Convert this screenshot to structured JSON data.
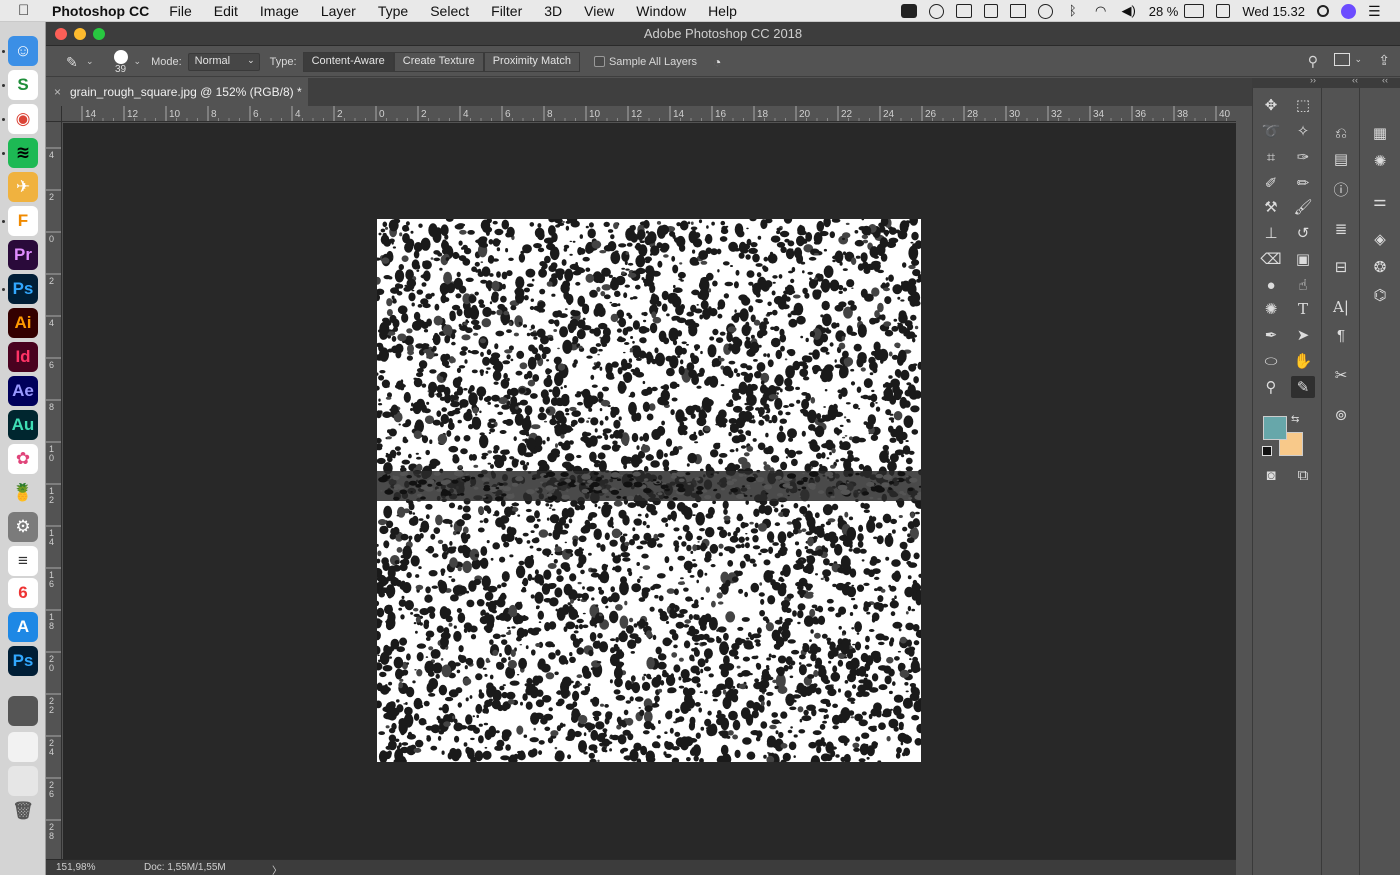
{
  "menubar": {
    "app_name": "Photoshop CC",
    "menus": [
      "File",
      "Edit",
      "Image",
      "Layer",
      "Type",
      "Select",
      "Filter",
      "3D",
      "View",
      "Window",
      "Help"
    ],
    "battery": "28 %",
    "clock": "Wed 15.32"
  },
  "window": {
    "title": "Adobe Photoshop CC 2018"
  },
  "options_bar": {
    "brush_size": "39",
    "mode_label": "Mode:",
    "mode_value": "Normal",
    "type_label": "Type:",
    "type_options": [
      "Content-Aware",
      "Create Texture",
      "Proximity Match"
    ],
    "sample_all_layers": "Sample All Layers"
  },
  "document": {
    "tab_title": "grain_rough_square.jpg @ 152% (RGB/8) *"
  },
  "ruler": {
    "top_ticks": [
      "14",
      "12",
      "10",
      "8",
      "6",
      "4",
      "2",
      "0",
      "2",
      "4",
      "6",
      "8",
      "10",
      "12",
      "14",
      "16",
      "18",
      "20",
      "22",
      "24",
      "26",
      "28",
      "30",
      "32",
      "34",
      "36",
      "38",
      "40"
    ],
    "left_ticks": [
      "4",
      "2",
      "0",
      "2",
      "4",
      "6",
      "8",
      "10",
      "12",
      "14",
      "16",
      "18",
      "20",
      "22",
      "24",
      "26",
      "28",
      "3"
    ]
  },
  "status": {
    "zoom": "151,98%",
    "doc_size": "Doc: 1,55M/1,55M",
    "arrow": "〉"
  },
  "colors": {
    "foreground": "#67a7aa",
    "background": "#f8c98a"
  },
  "dock_apps": [
    {
      "icon": "finder-icon",
      "label": "☺"
    },
    {
      "icon": "sheets-icon",
      "label": "S"
    },
    {
      "icon": "chrome-icon",
      "label": "◉"
    },
    {
      "icon": "spotify-icon",
      "label": "≋"
    },
    {
      "icon": "transmit-icon",
      "label": "✈"
    },
    {
      "icon": "fontlab-icon",
      "label": "F"
    },
    {
      "icon": "premiere-icon",
      "label": "Pr"
    },
    {
      "icon": "photoshop-icon",
      "label": "Ps"
    },
    {
      "icon": "illustrator-icon",
      "label": "Ai"
    },
    {
      "icon": "indesign-icon",
      "label": "Id"
    },
    {
      "icon": "aftereffects-icon",
      "label": "Ae"
    },
    {
      "icon": "audition-icon",
      "label": "Au"
    },
    {
      "icon": "photos-icon",
      "label": "✿"
    },
    {
      "icon": "fruit-icon",
      "label": "🍍"
    },
    {
      "icon": "system-preferences-icon",
      "label": "⚙"
    },
    {
      "icon": "reminders-icon",
      "label": "≡"
    },
    {
      "icon": "calendar-icon",
      "label": "6"
    },
    {
      "icon": "appstore-icon",
      "label": "A"
    },
    {
      "icon": "photoshop-icon-2",
      "label": "Ps"
    },
    {
      "icon": "screen-thumb-1-icon",
      "label": ""
    },
    {
      "icon": "screen-thumb-2-icon",
      "label": ""
    },
    {
      "icon": "screen-thumb-3-icon",
      "label": ""
    },
    {
      "icon": "trash-icon",
      "label": "🗑"
    }
  ]
}
